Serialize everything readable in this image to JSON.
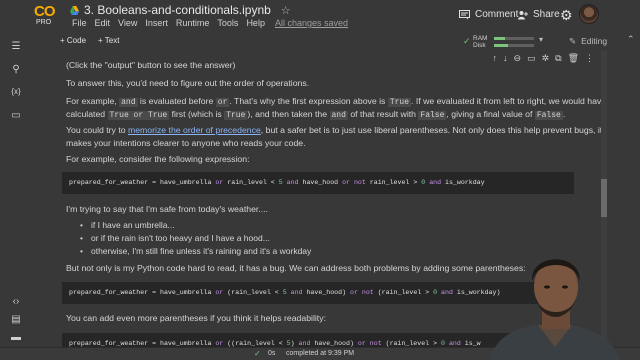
{
  "header": {
    "logo_text": "CO",
    "logo_sub": "PRO",
    "notebook_title": "3. Booleans-and-conditionals.ipynb",
    "menu": [
      "File",
      "Edit",
      "View",
      "Insert",
      "Runtime",
      "Tools",
      "Help"
    ],
    "save_status": "All changes saved",
    "comment_label": "Comment",
    "share_label": "Share"
  },
  "toolbar": {
    "code_label": "+ Code",
    "text_label": "+ Text",
    "ram_label": "RAM",
    "disk_label": "Disk",
    "ram_fraction": 0.28,
    "disk_fraction": 0.34,
    "editing_label": "Editing"
  },
  "content": {
    "p1": "(Click the \"output\" button to see the answer)",
    "p2": "To answer this, you'd need to figure out the order of operations.",
    "p3": {
      "t1": "For example, ",
      "c1": "and",
      "t2": " is evaluated before ",
      "c2": "or",
      "t3": ". That's why the first expression above is ",
      "c3": "True",
      "t4": ". If we evaluated it from left to right, we would have"
    },
    "p3b": {
      "t1": "calculated ",
      "c1": "True or True",
      "t2": " first (which is ",
      "c2": "True",
      "t3": "), and then taken the ",
      "c3": "and",
      "t4": " of that result with ",
      "c4": "False",
      "t5": ", giving a final value of ",
      "c5": "False",
      "t6": "."
    },
    "p4": {
      "t1": "You could try to ",
      "link": "memorize the order of precedence",
      "t2": ", but a safer bet is to just use liberal parentheses. Not only does this help prevent bugs, it"
    },
    "p4b": "makes your intentions clearer to anyone who reads your code.",
    "p5": "For example, consider the following expression:",
    "code1": {
      "a": "prepared_for_weather = have_umbrella ",
      "or1": "or",
      "b": " rain_level < ",
      "n1": "5",
      "and1": "and",
      "c": " have_hood ",
      "or2": "or",
      "not1": "not",
      "d": " rain_level > ",
      "n2": "0",
      "and2": "and",
      "e": " is_workday"
    },
    "p6": "I'm trying to say that I'm safe from today's weather....",
    "bullets": [
      "if I have an umbrella...",
      "or if the rain isn't too heavy and I have a hood...",
      "otherwise, I'm still fine unless it's raining and it's a workday"
    ],
    "p7": "But not only is my Python code hard to read, it has a bug. We can address both problems by adding some parentheses:",
    "code2": {
      "a": "prepared_for_weather = have_umbrella ",
      "or1": "or",
      "b": " (rain_level < ",
      "n1": "5",
      "and1": "and",
      "c": " have_hood) ",
      "or2": "or",
      "not1": "not",
      "d": " (rain_level > ",
      "n2": "0",
      "and2": "and",
      "e": " is_workday)"
    },
    "p8": "You can add even more parentheses if you think it helps readability:",
    "code3": {
      "a": "prepared_for_weather = have_umbrella ",
      "or1": "or",
      "b": " ((rain_level < ",
      "n1": "5",
      "c": ") ",
      "and1": "and",
      "d": " have_hood) ",
      "or2": "or",
      "not1": "not",
      "e": " (rain_level > ",
      "n2": "0",
      "and2": "and",
      "f": " is_w"
    }
  },
  "status": {
    "time": "0s",
    "message": "completed at 9:39 PM"
  },
  "colors": {
    "background": "#383838",
    "code_bg": "#262626",
    "link": "#8ab4f8",
    "keyword": "#c792ea",
    "number": "#7ec7a3",
    "accent_logo": "#f9ab00"
  }
}
